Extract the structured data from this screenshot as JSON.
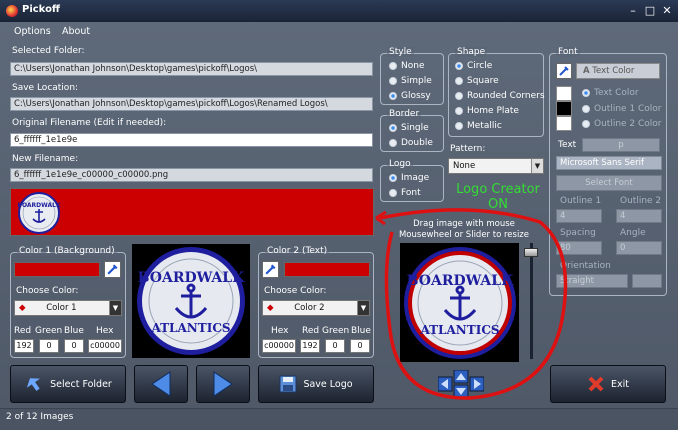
{
  "window": {
    "title": "Pickoff",
    "controls": [
      "–",
      "□",
      "✕"
    ]
  },
  "menu": {
    "items": [
      "Options",
      "About"
    ]
  },
  "fields": {
    "selected_folder_label": "Selected Folder:",
    "selected_folder_value": "C:\\Users\\Jonathan Johnson\\Desktop\\games\\pickoff\\Logos\\",
    "save_location_label": "Save Location:",
    "save_location_value": "C:\\Users\\Jonathan Johnson\\Desktop\\games\\pickoff\\Logos\\Renamed Logos\\",
    "original_filename_label": "Original Filename (Edit if needed):",
    "original_filename_value": "6_ffffff_1e1e9e",
    "new_filename_label": "New Filename:",
    "new_filename_value": "6_ffffff_1e1e9e_c00000_c00000.png"
  },
  "style": {
    "title": "Style",
    "options": [
      "None",
      "Simple",
      "Glossy"
    ],
    "selected": "Glossy"
  },
  "shape": {
    "title": "Shape",
    "options": [
      "Circle",
      "Square",
      "Rounded Corners",
      "Home Plate",
      "Metallic"
    ],
    "selected": "Circle"
  },
  "border": {
    "title": "Border",
    "options": [
      "Single",
      "Double"
    ],
    "selected": "Single"
  },
  "logo": {
    "title": "Logo",
    "options": [
      "Image",
      "Font"
    ],
    "selected": "Image"
  },
  "pattern": {
    "label": "Pattern:",
    "value": "None"
  },
  "annotation": {
    "line1": "Logo Creator",
    "line2": "ON"
  },
  "drag_hint": {
    "line1": "Drag image with mouse",
    "line2": "Mousewheel or Slider to resize"
  },
  "font": {
    "title": "Font",
    "text_color_button": "Text Color",
    "color_options": [
      "Text Color",
      "Outline 1 Color",
      "Outline 2 Color"
    ],
    "text_label": "Text",
    "text_value": "p",
    "font_name": "Microsoft Sans Serif",
    "select_font": "Select Font",
    "outline1_label": "Outline 1",
    "outline1_value": "4",
    "outline2_label": "Outline 2",
    "outline2_value": "4",
    "spacing_label": "Spacing",
    "spacing_value": "80",
    "angle_label": "Angle",
    "angle_value": "0",
    "orientation_label": "Orientation",
    "orientation_value": "Straight"
  },
  "color1": {
    "title": "Color 1 (Background)",
    "choose_label": "Choose Color:",
    "dropdown_value": "Color 1",
    "rgb_labels": [
      "Red",
      "Green",
      "Blue",
      "Hex"
    ],
    "values": [
      "192",
      "0",
      "0",
      "c00000"
    ]
  },
  "color2": {
    "title": "Color 2 (Text)",
    "choose_label": "Choose Color:",
    "dropdown_value": "Color 2",
    "rgb_labels": [
      "Hex",
      "Red",
      "Green",
      "Blue"
    ],
    "values": [
      "c00000",
      "192",
      "0",
      "0"
    ]
  },
  "logo_text": {
    "top": "BOARDWALK",
    "bottom": "ATLANTICS"
  },
  "buttons": {
    "select_folder": "Select Folder",
    "save_logo": "Save Logo",
    "exit": "Exit"
  },
  "status": {
    "text": "2 of 12 Images"
  },
  "colors": {
    "accent_red": "#cc0000",
    "logo_navy": "#1e1e9e",
    "annotation_green": "#33dd33",
    "annotation_red": "#dd1111"
  }
}
